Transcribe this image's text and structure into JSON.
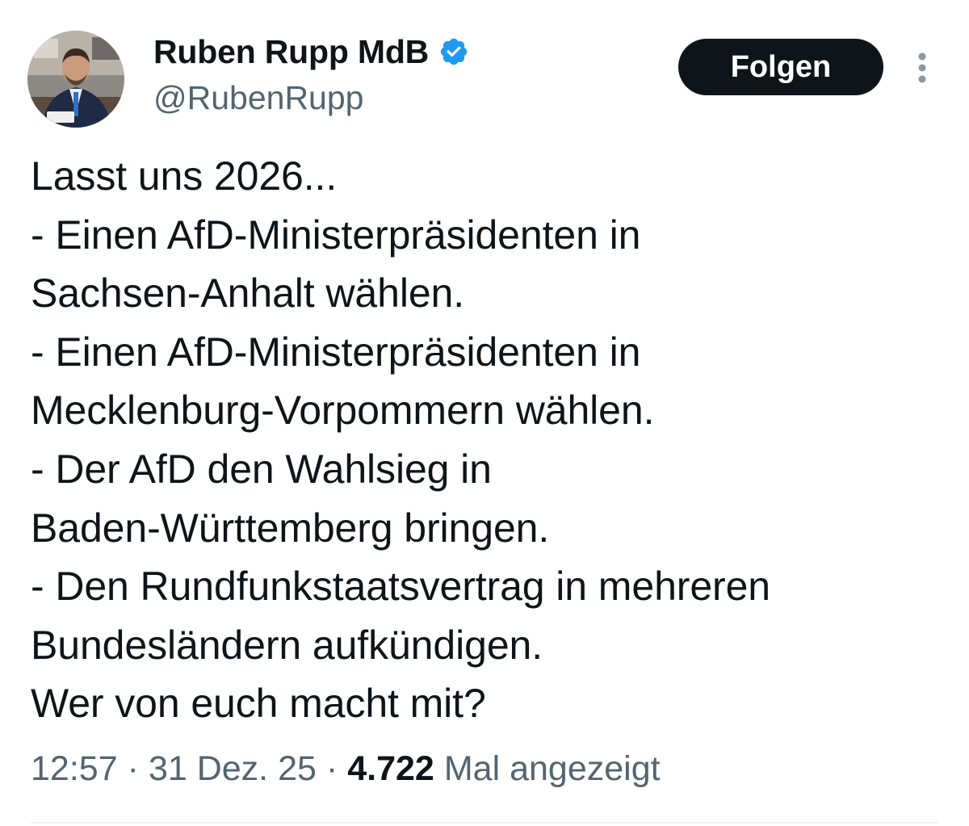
{
  "author": {
    "display_name": "Ruben Rupp MdB",
    "handle": "@RubenRupp",
    "verified_icon": "verified-badge-icon",
    "verified_color": "#1d9bf0"
  },
  "actions": {
    "follow_label": "Folgen",
    "more_icon": "more-vertical-icon"
  },
  "tweet": {
    "lines": [
      "Lasst uns 2026...",
      "- Einen AfD-Ministerpräsidenten in",
      "Sachsen-Anhalt wählen.",
      "- Einen AfD-Ministerpräsidenten in",
      "Mecklenburg-Vorpommern wählen.",
      "- Der AfD den Wahlsieg in",
      "Baden-Württemberg bringen.",
      "- Den Rundfunkstaatsvertrag in mehreren",
      "Bundesländern aufkündigen.",
      "Wer von euch macht mit?"
    ]
  },
  "meta": {
    "time": "12:57",
    "separator": "·",
    "date": "31 Dez. 25",
    "views_count": "4.722",
    "views_label": "Mal angezeigt"
  }
}
